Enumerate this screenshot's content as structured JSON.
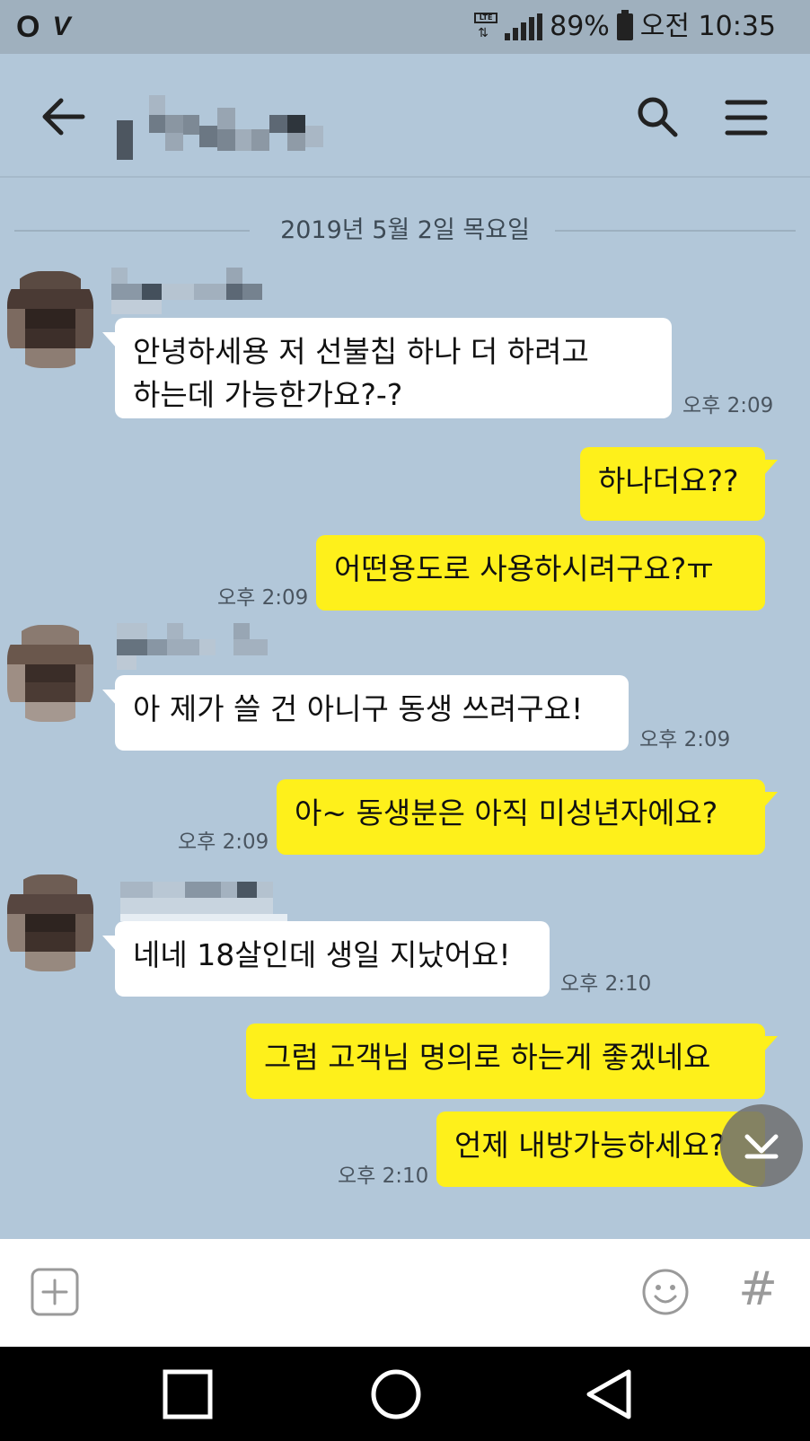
{
  "status_bar": {
    "carrier": "O",
    "v_icon": "V",
    "network": "LTE",
    "battery_percent": "89%",
    "time": "오전 10:35",
    "icons": [
      "carrier-icon",
      "vplus-icon",
      "lte-icon",
      "signal-icon",
      "battery-icon"
    ]
  },
  "header": {
    "icons": [
      "back-arrow-icon",
      "search-icon",
      "menu-icon"
    ]
  },
  "chat": {
    "date": "2019년 5월 2일 목요일",
    "messages": [
      {
        "side": "in",
        "text_lines": [
          "안녕하세용 저 선불칩 하나 더 하려고",
          "하는데 가능한가요?-?"
        ],
        "time": "오후 2:09"
      },
      {
        "side": "out",
        "text_lines": [
          "하나더요??"
        ],
        "time": ""
      },
      {
        "side": "out",
        "text_lines": [
          "어떤용도로 사용하시려구요?ㅠ"
        ],
        "time": "오후 2:09"
      },
      {
        "side": "in",
        "text_lines": [
          "아 제가 쓸 건 아니구 동생 쓰려구요!"
        ],
        "time": "오후 2:09"
      },
      {
        "side": "out",
        "text_lines": [
          "아~ 동생분은 아직 미성년자에요?"
        ],
        "time": "오후 2:09"
      },
      {
        "side": "in",
        "text_lines": [
          "네네 18살인데 생일 지났어요!"
        ],
        "time": "오후 2:10"
      },
      {
        "side": "out",
        "text_lines": [
          "그럼 고객님 명의로 하는게 좋겠네요"
        ],
        "time": ""
      },
      {
        "side": "out",
        "text_lines": [
          "언제 내방가능하세요?"
        ],
        "time": "오후 2:10"
      }
    ]
  },
  "input_bar": {
    "hash_label": "#",
    "icons": [
      "plus-icon",
      "emoji-icon",
      "hash-icon"
    ]
  },
  "nav_bar": {
    "icons": [
      "recent-apps-icon",
      "home-icon",
      "back-icon"
    ]
  },
  "colors": {
    "chat_background": "#b2c7d9",
    "status_bar": "#9fb0be",
    "incoming_bubble": "#ffffff",
    "outgoing_bubble": "#fef01b",
    "nav_bar": "#000000"
  }
}
